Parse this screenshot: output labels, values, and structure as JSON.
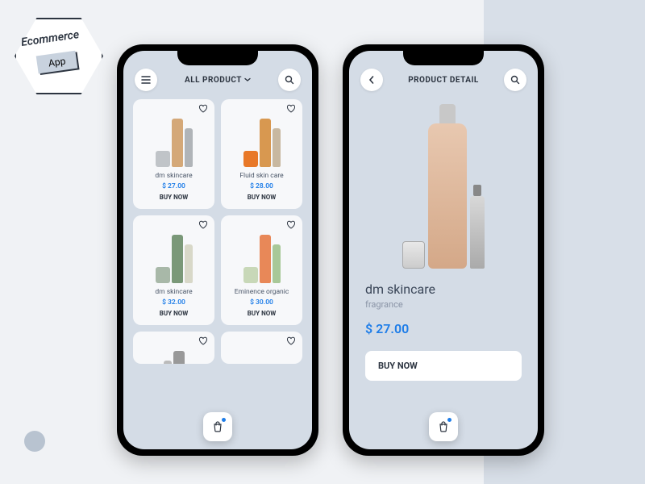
{
  "badge": {
    "title": "Ecommerce",
    "subtitle": "App"
  },
  "listing": {
    "header_title": "ALL PRODUCT",
    "products": [
      {
        "name": "dm skincare",
        "price": "$ 27.00",
        "buy": "BUY NOW",
        "colors": [
          "#c0c4c8",
          "#d4a878",
          "#b0b4b8"
        ]
      },
      {
        "name": "Fluid skin care",
        "price": "$ 28.00",
        "buy": "BUY NOW",
        "colors": [
          "#e87828",
          "#d89850",
          "#c8b8a0"
        ]
      },
      {
        "name": "dm skincare",
        "price": "$ 32.00",
        "buy": "BUY NOW",
        "colors": [
          "#a8b8a8",
          "#7a9878",
          "#d8d8c8"
        ]
      },
      {
        "name": "Eminence organic",
        "price": "$ 30.00",
        "buy": "BUY NOW",
        "colors": [
          "#c8d8b8",
          "#e88858",
          "#a8c898"
        ]
      }
    ]
  },
  "detail": {
    "header_title": "PRODUCT DETAIL",
    "name": "dm skincare",
    "category": "fragrance",
    "price": "$ 27.00",
    "buy": "BUY NOW"
  }
}
